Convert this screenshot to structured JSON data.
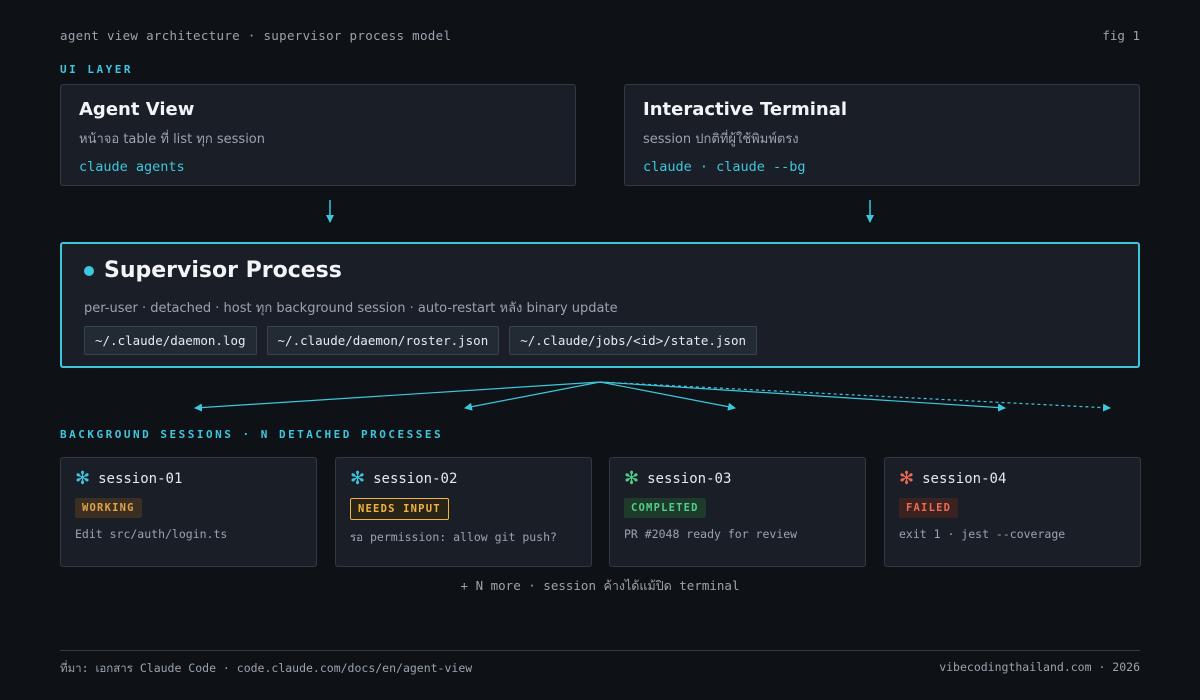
{
  "header": {
    "caption": "agent view architecture · supervisor process model",
    "fig": "fig 1"
  },
  "ui_layer": {
    "label": "UI LAYER",
    "cards": [
      {
        "title": "Agent View",
        "desc": "หน้าจอ table ที่ list ทุก session",
        "cmd": "claude agents"
      },
      {
        "title": "Interactive Terminal",
        "desc": "session ปกติที่ผู้ใช้พิมพ์ตรง",
        "cmd": "claude · claude --bg"
      }
    ]
  },
  "supervisor": {
    "title": "Supervisor Process",
    "desc": "per-user · detached · host ทุก background session · auto-restart หลัง binary update",
    "paths": [
      "~/.claude/daemon.log",
      "~/.claude/daemon/roster.json",
      "~/.claude/jobs/<id>/state.json"
    ]
  },
  "background": {
    "label": "BACKGROUND SESSIONS · N DETACHED PROCESSES",
    "sessions": [
      {
        "name": "session-01",
        "status": "WORKING",
        "text": "Edit src/auth/login.ts",
        "icon": "asterisk-icon"
      },
      {
        "name": "session-02",
        "status": "NEEDS INPUT",
        "text": "รอ permission: allow git push?",
        "icon": "asterisk-icon"
      },
      {
        "name": "session-03",
        "status": "COMPLETED",
        "text": "PR #2048 ready for review",
        "icon": "asterisk-icon"
      },
      {
        "name": "session-04",
        "status": "FAILED",
        "text": "exit 1 · jest --coverage",
        "icon": "asterisk-icon"
      }
    ],
    "more": "+ N more · session ค้างได้แม้ปิด terminal"
  },
  "footer": {
    "source": "ที่มา: เอกสาร Claude Code · code.claude.com/docs/en/agent-view",
    "credit": "vibecodingthailand.com · 2026"
  },
  "colors": {
    "accent": "#3ec6dc",
    "background": "#0e1217",
    "card": "#1a1f27",
    "working": "#e0a24a",
    "needs_input": "#f0b541",
    "completed": "#4fcf8a",
    "failed": "#ee6a55"
  }
}
